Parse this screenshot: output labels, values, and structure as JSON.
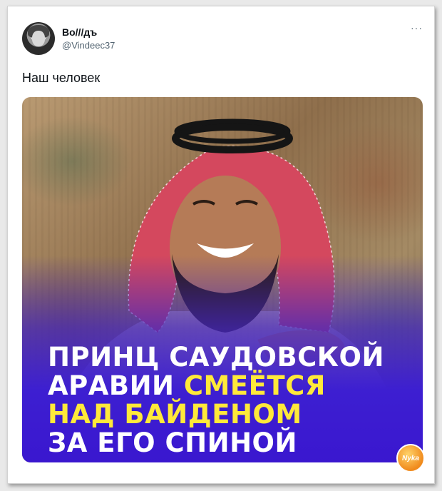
{
  "tweet": {
    "author_name": "Во///дъ",
    "author_handle": "@Vindeec37",
    "more_label": "···",
    "text": "Наш человек"
  },
  "media": {
    "headline_lines": [
      {
        "text": "ПРИНЦ САУДОВСКОЙ",
        "segments": [
          {
            "t": "ПРИНЦ САУДОВСКОЙ",
            "color": "white"
          }
        ]
      },
      {
        "text": "АРАВИИ СМЕЁТСЯ",
        "segments": [
          {
            "t": "АРАВИИ ",
            "color": "white"
          },
          {
            "t": "СМЕЁТСЯ",
            "color": "yellow"
          }
        ]
      },
      {
        "text": "НАД БАЙДЕНОМ",
        "segments": [
          {
            "t": "НАД БАЙДЕНОМ",
            "color": "yellow"
          }
        ]
      },
      {
        "text": "ЗА ЕГО СПИНОЙ",
        "segments": [
          {
            "t": "ЗА ЕГО СПИНОЙ",
            "color": "white"
          }
        ]
      }
    ],
    "colors": {
      "white": "#ffffff",
      "yellow": "#ffe93a",
      "purple": "#3a17cf"
    }
  },
  "watermark": {
    "text": "Nyka"
  }
}
